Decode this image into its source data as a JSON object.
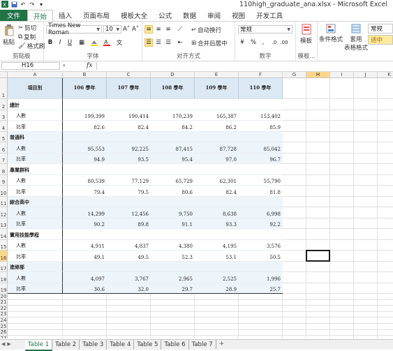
{
  "window": {
    "title": "110high_graduate_ana.xlsx - Microsoft Excel"
  },
  "menu": {
    "file": "文件",
    "tabs": [
      "开始",
      "插入",
      "页面布局",
      "模板大全",
      "公式",
      "数据",
      "审阅",
      "视图",
      "开发工具"
    ],
    "active_tab_index": 0
  },
  "ribbon": {
    "clipboard": {
      "label": "剪贴板",
      "paste": "粘贴",
      "cut": "剪切",
      "copy": "复制",
      "format_painter": "格式刷"
    },
    "font": {
      "label": "字体",
      "name": "Times New Roman",
      "size": "10",
      "bold": "B",
      "italic": "I",
      "underline": "U",
      "grow": "A˄",
      "shrink": "A˅"
    },
    "alignment": {
      "label": "对齐方式",
      "wrap": "自动换行",
      "merge": "合并后居中"
    },
    "number": {
      "label": "数字",
      "format": "常规",
      "percent": "%",
      "comma": ","
    },
    "templates": {
      "label": "模板...",
      "button": "模板"
    },
    "styles": {
      "conditional": "条件格式",
      "table": "套用\n表格格式",
      "normal": "常规",
      "medium": "适中"
    }
  },
  "formula_bar": {
    "name_box": "H16",
    "fx": "fx",
    "value": ""
  },
  "columns": [
    "A",
    "B",
    "C",
    "D",
    "E",
    "F",
    "G",
    "H",
    "I",
    "J",
    "K"
  ],
  "selected_column": "H",
  "selected_row": "16",
  "sheet": {
    "header": [
      "項目別",
      "106 學年",
      "107 學年",
      "108 學年",
      "109 學年",
      "110 學年"
    ],
    "rows": [
      {
        "r": "2",
        "label": "總計",
        "type": "group",
        "vals": [
          "",
          "",
          "",
          "",
          ""
        ]
      },
      {
        "r": "3",
        "label": "人數",
        "type": "item",
        "vals": [
          "199,399",
          "190,414",
          "170,239",
          "165,387",
          "153,402"
        ]
      },
      {
        "r": "4",
        "label": "比率",
        "type": "item",
        "vals": [
          "82.6",
          "82.4",
          "84.2",
          "86.2",
          "85.9"
        ]
      },
      {
        "r": "5",
        "label": "普通科",
        "type": "group",
        "vals": [
          "",
          "",
          "",
          "",
          ""
        ]
      },
      {
        "r": "6",
        "label": "人數",
        "type": "item",
        "vals": [
          "95,553",
          "92,225",
          "87,415",
          "87,728",
          "85,042"
        ]
      },
      {
        "r": "7",
        "label": "比率",
        "type": "item",
        "vals": [
          "94.9",
          "93.5",
          "95.4",
          "97.0",
          "96.7"
        ]
      },
      {
        "r": "8",
        "label": "專業群科",
        "type": "group",
        "vals": [
          "",
          "",
          "",
          "",
          ""
        ]
      },
      {
        "r": "9",
        "label": "人數",
        "type": "item",
        "vals": [
          "80,539",
          "77,129",
          "65,729",
          "62,301",
          "55,790"
        ]
      },
      {
        "r": "10",
        "label": "比率",
        "type": "item",
        "vals": [
          "79.4",
          "79.5",
          "80.6",
          "82.4",
          "81.8"
        ]
      },
      {
        "r": "11",
        "label": "綜合高中",
        "type": "group",
        "vals": [
          "",
          "",
          "",
          "",
          ""
        ]
      },
      {
        "r": "12",
        "label": "人數",
        "type": "item",
        "vals": [
          "14,299",
          "12,456",
          "9,750",
          "8,638",
          "6,998"
        ]
      },
      {
        "r": "13",
        "label": "比率",
        "type": "item",
        "vals": [
          "90.2",
          "89.8",
          "91.1",
          "93.3",
          "92.2"
        ]
      },
      {
        "r": "14",
        "label": "實用技能學程",
        "type": "group",
        "vals": [
          "",
          "",
          "",
          "",
          ""
        ]
      },
      {
        "r": "15",
        "label": "人數",
        "type": "item",
        "vals": [
          "4,911",
          "4,837",
          "4,380",
          "4,195",
          "3,576"
        ]
      },
      {
        "r": "16",
        "label": "比率",
        "type": "item",
        "vals": [
          "49.1",
          "49.5",
          "52.3",
          "53.1",
          "50.5"
        ]
      },
      {
        "r": "17",
        "label": "進修部",
        "type": "group",
        "vals": [
          "",
          "",
          "",
          "",
          ""
        ]
      },
      {
        "r": "18",
        "label": "人數",
        "type": "item",
        "vals": [
          "4,097",
          "3,767",
          "2,965",
          "2,525",
          "1,996"
        ]
      },
      {
        "r": "19",
        "label": "比率",
        "type": "item",
        "vals": [
          "30.6",
          "32.0",
          "29.7",
          "28.9",
          "25.7"
        ]
      }
    ],
    "empty_rows": [
      "20",
      "21",
      "22",
      "23",
      "24",
      "25",
      "26",
      "27",
      "28",
      "29"
    ]
  },
  "sheets": {
    "tabs": [
      "Table 1",
      "Table 2",
      "Table 3",
      "Table 4",
      "Table 5",
      "Table 6",
      "Table 7"
    ],
    "active_index": 0,
    "add": "+"
  }
}
